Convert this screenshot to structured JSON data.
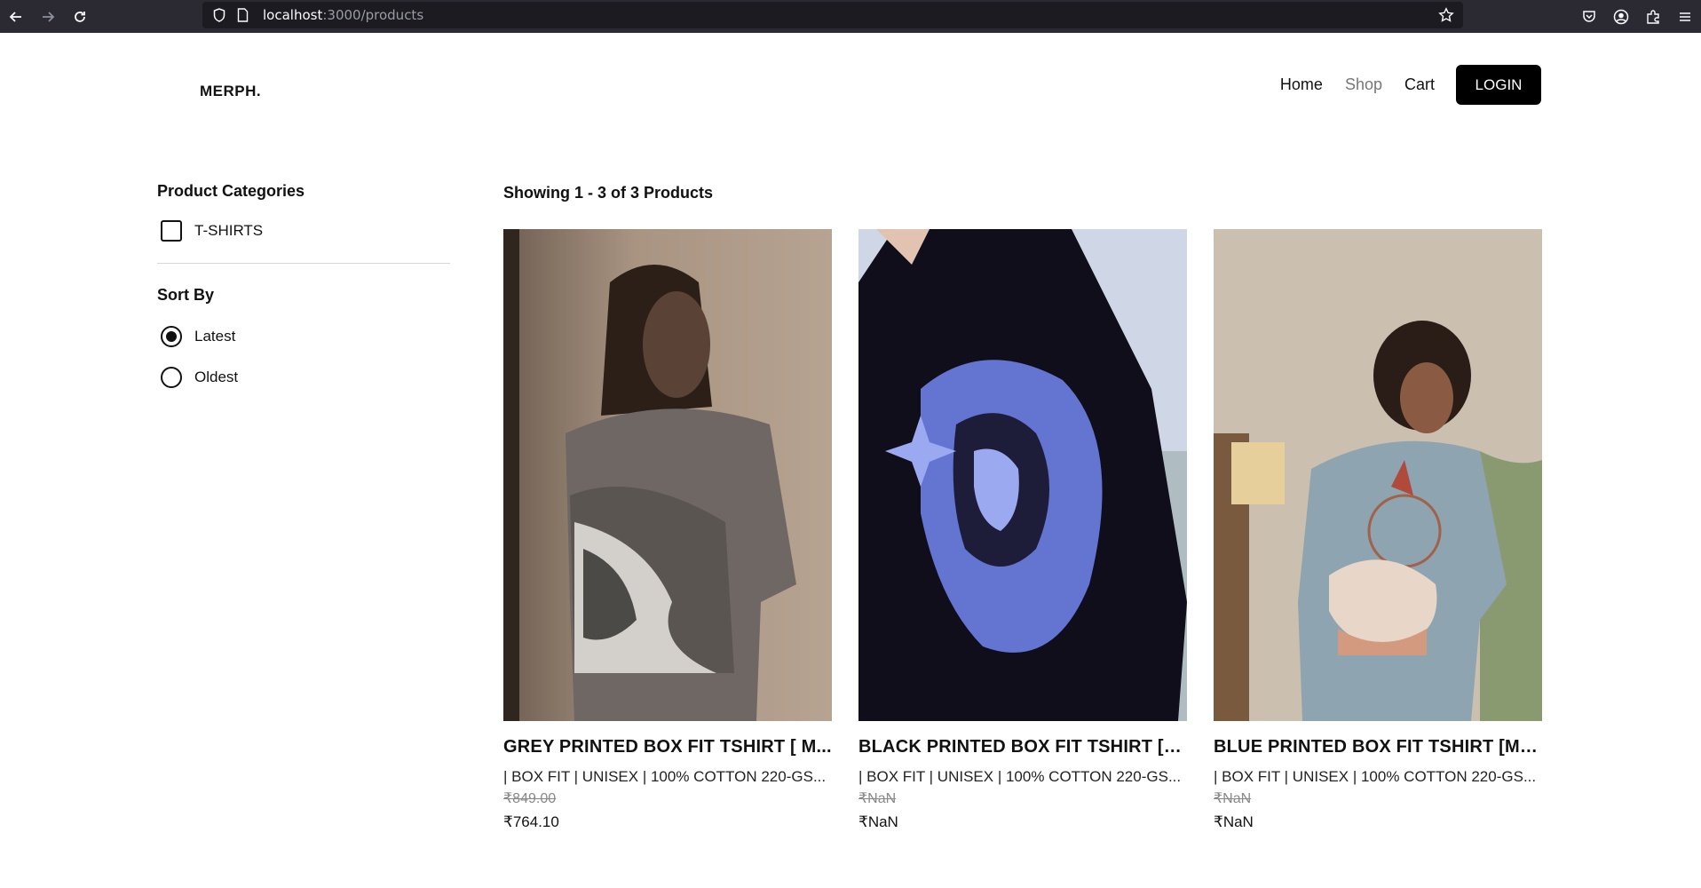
{
  "browser": {
    "url_host": "localhost",
    "url_path": ":3000/products",
    "icons": [
      "back-arrow-icon",
      "forward-arrow-icon",
      "reload-icon",
      "shield-icon",
      "page-icon",
      "bookmark-star-icon",
      "pocket-icon",
      "account-icon",
      "extensions-icon",
      "menu-icon"
    ]
  },
  "header": {
    "logo": "MERPH.",
    "nav": [
      {
        "label": "Home"
      },
      {
        "label": "Shop"
      },
      {
        "label": "Cart"
      }
    ],
    "login_label": "LOGIN"
  },
  "sidebar": {
    "categories_heading": "Product Categories",
    "categories": [
      {
        "label": "T-SHIRTS",
        "checked": false
      }
    ],
    "sort_heading": "Sort By",
    "sort_options": [
      {
        "label": "Latest",
        "selected": true
      },
      {
        "label": "Oldest",
        "selected": false
      }
    ]
  },
  "main": {
    "results_title": "Showing 1 - 3 of 3 Products",
    "products": [
      {
        "title": "GREY PRINTED BOX FIT TSHIRT [ M...",
        "description": "| BOX FIT | UNISEX | 100% COTTON 220-GS...",
        "old_price": "₹849.00",
        "price": "₹764.10"
      },
      {
        "title": "BLACK PRINTED BOX FIT TSHIRT [M...",
        "description": "| BOX FIT | UNISEX | 100% COTTON 220-GS...",
        "old_price": "₹NaN",
        "price": "₹NaN"
      },
      {
        "title": "BLUE PRINTED BOX FIT TSHIRT [MY...",
        "description": "| BOX FIT | UNISEX | 100% COTTON 220-GS...",
        "old_price": "₹NaN",
        "price": "₹NaN"
      }
    ]
  }
}
